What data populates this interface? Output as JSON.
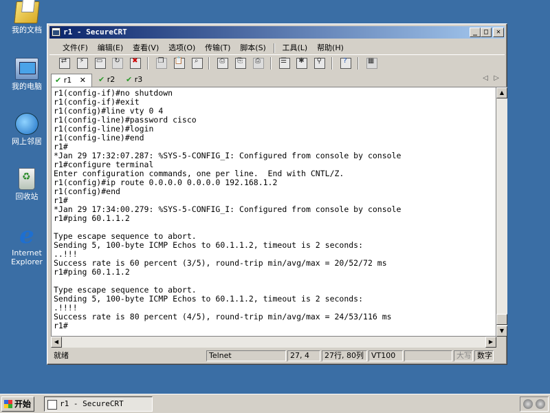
{
  "desktop": {
    "icons": [
      {
        "label": "我的文档"
      },
      {
        "label": "我的电脑"
      },
      {
        "label": "网上邻居"
      },
      {
        "label": "回收站"
      },
      {
        "label": "Internet Explorer",
        "line1": "Internet",
        "line2": "Explorer"
      }
    ]
  },
  "window": {
    "title": "r1 - SecureCRT",
    "controls": {
      "minimize": "_",
      "maximize": "□",
      "close": "✕"
    }
  },
  "menubar": {
    "items": [
      "文件(F)",
      "编辑(E)",
      "查看(V)",
      "选项(O)",
      "传输(T)",
      "脚本(S)",
      "工具(L)",
      "帮助(H)"
    ]
  },
  "tabs": {
    "items": [
      {
        "label": "r1",
        "active": true,
        "close": "✕"
      },
      {
        "label": "r2",
        "active": false
      },
      {
        "label": "r3",
        "active": false
      }
    ],
    "nav_left": "◁",
    "nav_right": "▷"
  },
  "terminal": {
    "lines": [
      "r1(config-if)#no shutdown",
      "r1(config-if)#exit",
      "r1(config)#line vty 0 4",
      "r1(config-line)#password cisco",
      "r1(config-line)#login",
      "r1(config-line)#end",
      "r1#",
      "*Jan 29 17:32:07.287: %SYS-5-CONFIG_I: Configured from console by console",
      "r1#configure terminal",
      "Enter configuration commands, one per line.  End with CNTL/Z.",
      "r1(config)#ip route 0.0.0.0 0.0.0.0 192.168.1.2",
      "r1(config)#end",
      "r1#",
      "*Jan 29 17:34:00.279: %SYS-5-CONFIG_I: Configured from console by console",
      "r1#ping 60.1.1.2",
      "",
      "Type escape sequence to abort.",
      "Sending 5, 100-byte ICMP Echos to 60.1.1.2, timeout is 2 seconds:",
      "..!!!",
      "Success rate is 60 percent (3/5), round-trip min/avg/max = 20/52/72 ms",
      "r1#ping 60.1.1.2",
      "",
      "Type escape sequence to abort.",
      "Sending 5, 100-byte ICMP Echos to 60.1.1.2, timeout is 2 seconds:",
      ".!!!!",
      "Success rate is 80 percent (4/5), round-trip min/avg/max = 24/53/116 ms",
      "r1#"
    ]
  },
  "statusbar": {
    "status": "就绪",
    "protocol": "Telnet",
    "cursor": "27, 4",
    "size": "27行, 80列",
    "emulation": "VT100",
    "caps": "大写",
    "num": "数字"
  },
  "taskbar": {
    "start_label": "开始",
    "task_title": "r1 - SecureCRT"
  }
}
